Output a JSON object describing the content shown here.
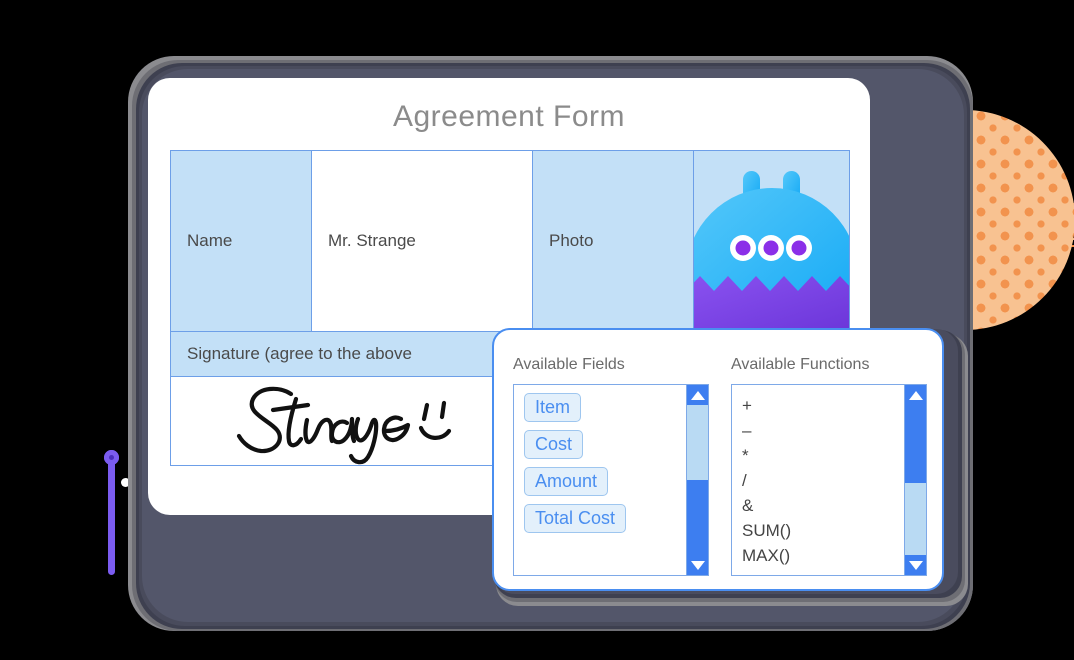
{
  "form": {
    "title": "Agreement Form",
    "rows": [
      {
        "label": "Name",
        "value": "Mr. Strange"
      },
      {
        "label": "Photo",
        "value": ""
      }
    ],
    "signature": {
      "label": "Signature (agree to the above",
      "value": "Strange"
    }
  },
  "popup": {
    "fields_title": "Available Fields",
    "functions_title": "Available Functions",
    "fields": [
      "Item",
      "Cost",
      "Amount",
      "Total Cost"
    ],
    "functions": [
      "+",
      "–",
      "*",
      "/",
      "&",
      "SUM()",
      "MAX()"
    ]
  },
  "colors": {
    "cell_fill": "#c3e0f7",
    "cell_border": "#6d9fe8",
    "accent_blue": "#3d7ef0",
    "chip_fill": "#e3f0fb",
    "chip_text": "#4a8ef0",
    "title_gray": "#8b8b8b",
    "monster_blue": "#3fb6f5",
    "monster_purple": "#7b4ae0",
    "eye_purple": "#8b2fe8",
    "orange": "#f79044",
    "teal": "#2cc6c0",
    "pink": "#fb8ba0",
    "purple_pin": "#7b5cf0",
    "bezel_dark": "#3e4050"
  }
}
